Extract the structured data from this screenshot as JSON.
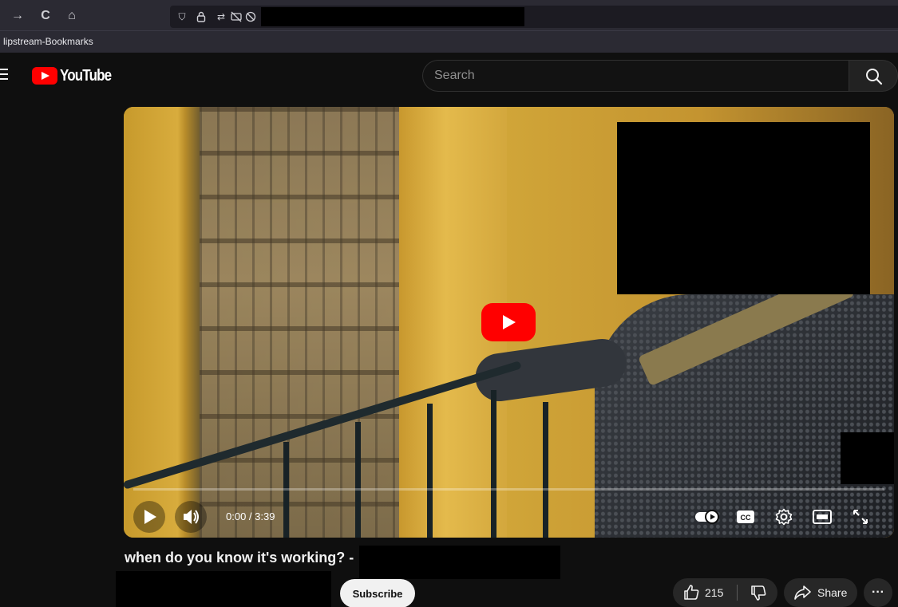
{
  "browser": {
    "nav": {
      "forward_glyph": "→",
      "reload_glyph": "C",
      "home_glyph": "⌂"
    },
    "url_icons": {
      "shield": "⛉",
      "lock": "🔒",
      "extra": "⇄"
    },
    "bookmarks": [
      {
        "label": "lipstream-Bookmarks"
      }
    ]
  },
  "header": {
    "logo_text": "YouTube",
    "search": {
      "placeholder": "Search"
    }
  },
  "player": {
    "time_display": "0:00 / 3:39",
    "progress": 0
  },
  "video": {
    "title": "when do you know it's working? -",
    "subscribe_label": "Subscribe",
    "likes": "215",
    "share_label": "Share",
    "more_label": "···"
  },
  "colors": {
    "brand_red": "#ff0000",
    "background": "#0f0f0f",
    "chip": "#272727"
  }
}
